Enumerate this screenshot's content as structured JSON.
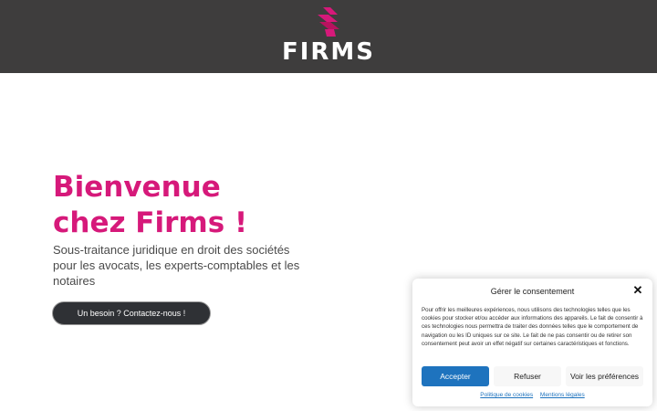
{
  "header": {
    "logo_text": "FIRMS",
    "colors": {
      "background": "#3e3d3d",
      "brand": "#d6197a"
    }
  },
  "hero": {
    "title_line1": "Bienvenue",
    "title_line2": "chez Firms !",
    "subtitle": "Sous-traitance juridique en droit des sociétés pour les avocats, les experts-comptables et les notaires",
    "cta_label": "Un besoin ? Contactez-nous !"
  },
  "consent": {
    "title": "Gérer le consentement",
    "close_icon": "close-icon",
    "text": "Pour offrir les meilleures expériences, nous utilisons des technologies telles que les cookies pour stocker et/ou accéder aux informations des appareils. Le fait de consentir à ces technologies nous permettra de traiter des données telles que le comportement de navigation ou les ID uniques sur ce site. Le fait de ne pas consentir ou de retirer son consentement peut avoir un effet négatif sur certaines caractéristiques et fonctions.",
    "accept_label": "Accepter",
    "refuse_label": "Refuser",
    "prefs_label": "Voir les préférences",
    "cookie_policy_link": "Politique de cookies",
    "legal_link": "Mentions légales",
    "accent_color": "#1e73be"
  }
}
